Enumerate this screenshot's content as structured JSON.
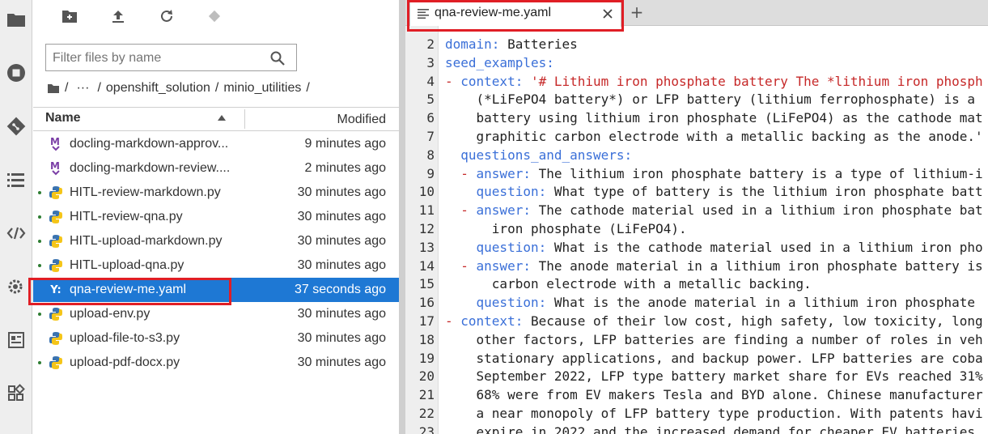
{
  "sidebar": {
    "icons": [
      "folder-icon",
      "stop-circle-icon",
      "git-icon",
      "list-icon",
      "code-icon",
      "extension-gear-icon",
      "property-inspector-icon",
      "puzzle-icon"
    ]
  },
  "toolbar": {
    "icons": [
      "new-folder-icon",
      "upload-icon",
      "refresh-icon",
      "git-clone-icon"
    ]
  },
  "filter": {
    "placeholder": "Filter files by name",
    "value": ""
  },
  "breadcrumb": {
    "root_sep": "/",
    "ellipsis": "···",
    "parts": [
      "openshift_solution",
      "minio_utilities"
    ],
    "sep": "/"
  },
  "columns": {
    "name": "Name",
    "modified": "Modified",
    "sort": "ascending"
  },
  "files": [
    {
      "name": "docling-markdown-approv...",
      "modified": "9 minutes ago",
      "type": "markdown",
      "running": false
    },
    {
      "name": "docling-markdown-review....",
      "modified": "2 minutes ago",
      "type": "markdown",
      "running": false
    },
    {
      "name": "HITL-review-markdown.py",
      "modified": "30 minutes ago",
      "type": "python",
      "running": true
    },
    {
      "name": "HITL-review-qna.py",
      "modified": "30 minutes ago",
      "type": "python",
      "running": true
    },
    {
      "name": "HITL-upload-markdown.py",
      "modified": "30 minutes ago",
      "type": "python",
      "running": true
    },
    {
      "name": "HITL-upload-qna.py",
      "modified": "30 minutes ago",
      "type": "python",
      "running": true
    },
    {
      "name": "qna-review-me.yaml",
      "modified": "37 seconds ago",
      "type": "yaml",
      "running": false,
      "selected": true
    },
    {
      "name": "upload-env.py",
      "modified": "30 minutes ago",
      "type": "python",
      "running": true
    },
    {
      "name": "upload-file-to-s3.py",
      "modified": "30 minutes ago",
      "type": "python",
      "running": false
    },
    {
      "name": "upload-pdf-docx.py",
      "modified": "30 minutes ago",
      "type": "python",
      "running": true
    }
  ],
  "file_icon_glyphs": {
    "markdown": "M",
    "yaml": "Y:"
  },
  "editor": {
    "tab_title": "qna-review-me.yaml",
    "add_tab": "+",
    "lines": [
      {
        "n": "2",
        "parts": [
          [
            "k",
            "domain:"
          ],
          [
            "t",
            " Batteries"
          ]
        ]
      },
      {
        "n": "3",
        "parts": [
          [
            "k",
            "seed_examples:"
          ]
        ]
      },
      {
        "n": "4",
        "parts": [
          [
            "r",
            "- "
          ],
          [
            "k",
            "context:"
          ],
          [
            "r",
            " '# Lithium iron phosphate battery The *lithium iron phosph"
          ]
        ]
      },
      {
        "n": "5",
        "parts": [
          [
            "t",
            "    (*LiFePO4 battery*) or LFP battery (lithium ferrophosphate) is a "
          ]
        ]
      },
      {
        "n": "6",
        "parts": [
          [
            "t",
            "    battery using lithium iron phosphate (LiFePO4) as the cathode mat"
          ]
        ]
      },
      {
        "n": "7",
        "parts": [
          [
            "t",
            "    graphitic carbon electrode with a metallic backing as the anode.'"
          ]
        ]
      },
      {
        "n": "8",
        "parts": [
          [
            "k",
            "  questions_and_answers:"
          ]
        ]
      },
      {
        "n": "9",
        "parts": [
          [
            "r",
            "  - "
          ],
          [
            "k",
            "answer:"
          ],
          [
            "t",
            " The lithium iron phosphate battery is a type of lithium-i"
          ]
        ]
      },
      {
        "n": "10",
        "parts": [
          [
            "k",
            "    question:"
          ],
          [
            "t",
            " What type of battery is the lithium iron phosphate batt"
          ]
        ]
      },
      {
        "n": "11",
        "parts": [
          [
            "r",
            "  - "
          ],
          [
            "k",
            "answer:"
          ],
          [
            "t",
            " The cathode material used in a lithium iron phosphate bat"
          ]
        ]
      },
      {
        "n": "12",
        "parts": [
          [
            "t",
            "      iron phosphate (LiFePO4)."
          ]
        ]
      },
      {
        "n": "13",
        "parts": [
          [
            "k",
            "    question:"
          ],
          [
            "t",
            " What is the cathode material used in a lithium iron pho"
          ]
        ]
      },
      {
        "n": "14",
        "parts": [
          [
            "r",
            "  - "
          ],
          [
            "k",
            "answer:"
          ],
          [
            "t",
            " The anode material in a lithium iron phosphate battery is"
          ]
        ]
      },
      {
        "n": "15",
        "parts": [
          [
            "t",
            "      carbon electrode with a metallic backing."
          ]
        ]
      },
      {
        "n": "16",
        "parts": [
          [
            "k",
            "    question:"
          ],
          [
            "t",
            " What is the anode material in a lithium iron phosphate "
          ]
        ]
      },
      {
        "n": "17",
        "parts": [
          [
            "r",
            "- "
          ],
          [
            "k",
            "context:"
          ],
          [
            "t",
            " Because of their low cost, high safety, low toxicity, long"
          ]
        ]
      },
      {
        "n": "18",
        "parts": [
          [
            "t",
            "    other factors, LFP batteries are finding a number of roles in veh"
          ]
        ]
      },
      {
        "n": "19",
        "parts": [
          [
            "t",
            "    stationary applications, and backup power. LFP batteries are coba"
          ]
        ]
      },
      {
        "n": "20",
        "parts": [
          [
            "t",
            "    September 2022, LFP type battery market share for EVs reached 31%"
          ]
        ]
      },
      {
        "n": "21",
        "parts": [
          [
            "t",
            "    68% were from EV makers Tesla and BYD alone. Chinese manufacturer"
          ]
        ]
      },
      {
        "n": "22",
        "parts": [
          [
            "t",
            "    a near monopoly of LFP battery type production. With patents havi"
          ]
        ]
      },
      {
        "n": "23",
        "parts": [
          [
            "t",
            "    expire in 2022 and the increased demand for cheaper EV batteries,"
          ]
        ]
      }
    ]
  },
  "colors": {
    "accent": "#1e78d4",
    "highlight_box": "#e01e25",
    "yaml_key": "#3a6fd8",
    "yaml_string": "#c62828"
  }
}
